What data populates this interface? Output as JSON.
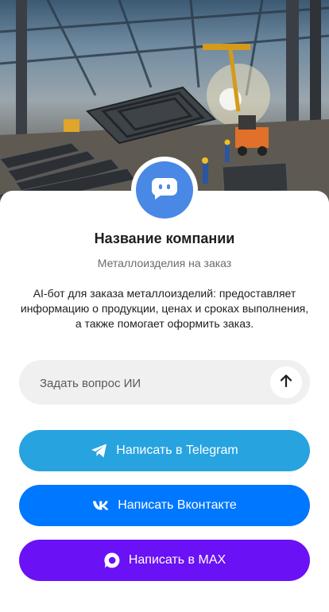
{
  "hero": {
    "image": "metal-workshop-photo"
  },
  "avatar": {
    "icon": "chat-bot-icon",
    "color": "#4a88e5"
  },
  "company": {
    "name": "Название компании",
    "tagline": "Металлоизделия на заказ",
    "description": "AI-бот для заказа металлоизделий: предоставляет информацию о продукции, ценах и сроках выполнения, а также помогает оформить заказ."
  },
  "ask": {
    "placeholder": "Задать вопрос ИИ",
    "value": "",
    "send_icon": "arrow-up-icon"
  },
  "buttons": {
    "telegram": {
      "label": "Написать в Telegram",
      "icon": "telegram-icon",
      "color": "#27a3e0"
    },
    "vk": {
      "label": "Написать Вконтакте",
      "icon": "vk-icon",
      "color": "#0077ff"
    },
    "max": {
      "label": "Написать в MAX",
      "icon": "max-icon",
      "color": "#6a11f5"
    }
  }
}
